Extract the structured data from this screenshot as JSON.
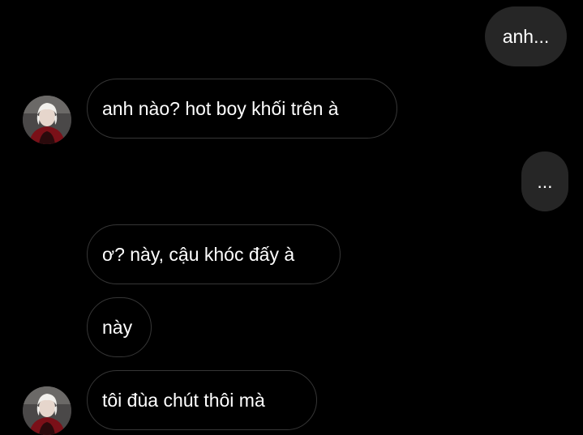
{
  "conversation": {
    "messages": [
      {
        "sender": "me",
        "text": "anh..."
      },
      {
        "sender": "them",
        "text": "anh nào? hot boy khối trên à"
      },
      {
        "sender": "me",
        "text": "..."
      },
      {
        "sender": "them",
        "text": "ơ? này, cậu khóc đấy à"
      },
      {
        "sender": "them",
        "text": "này"
      },
      {
        "sender": "them",
        "text": "tôi đùa chút thôi mà"
      }
    ]
  },
  "theme": {
    "background": "#000000",
    "sent_bubble": "#262626",
    "received_border": "#363636",
    "text_color": "#ffffff"
  },
  "icons": {
    "contact_avatar": "avatar-photo-icon"
  }
}
